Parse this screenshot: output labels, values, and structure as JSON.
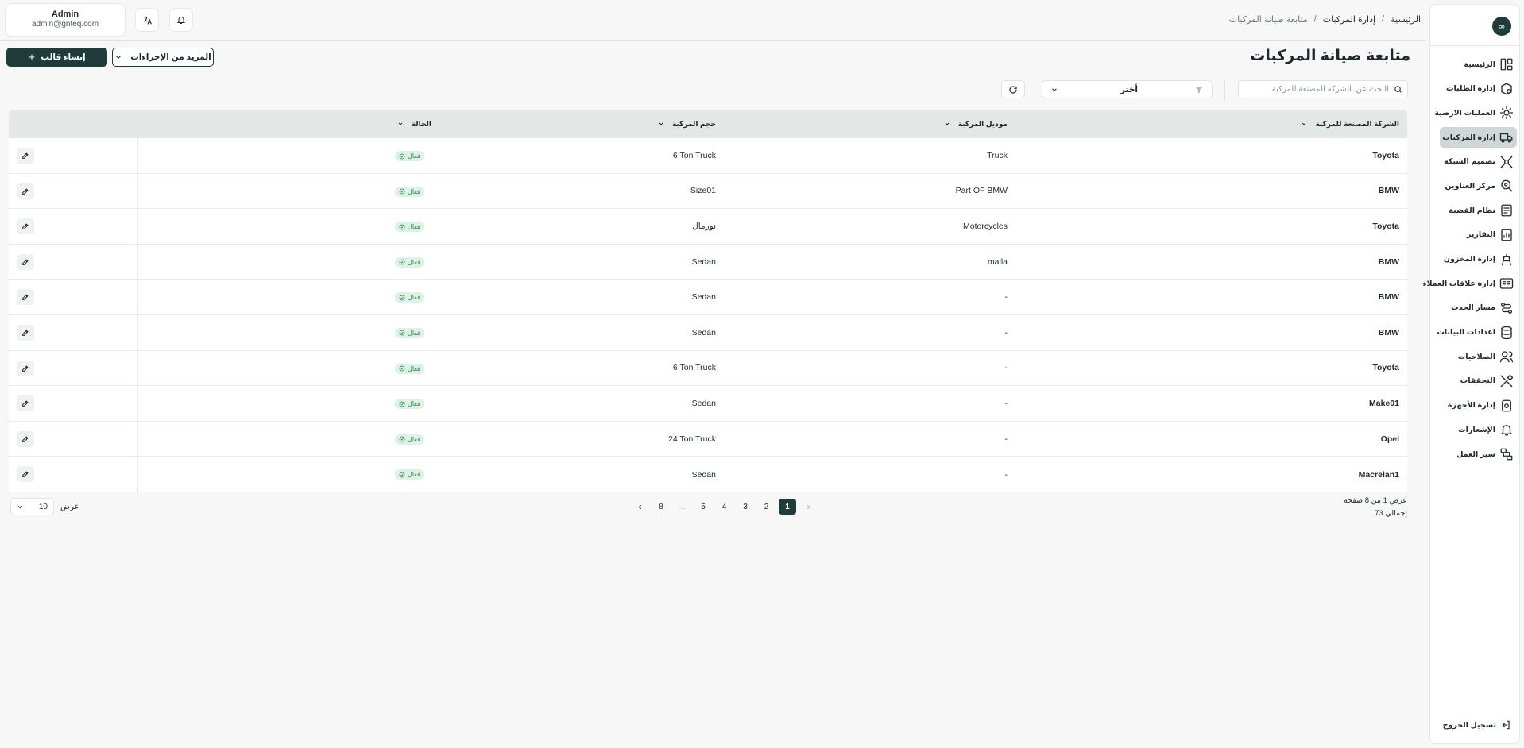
{
  "sidebar": {
    "logo_text": "∞",
    "items": [
      {
        "label": "الرئيسية",
        "icon": "layout-icon"
      },
      {
        "label": "إدارة الطلبات",
        "icon": "order-box-icon"
      },
      {
        "label": "العمليات الارضية",
        "icon": "sun-icon"
      },
      {
        "label": "إدارة المركبات",
        "icon": "truck-icon",
        "active": true
      },
      {
        "label": "تصميم الشبكة",
        "icon": "network-icon"
      },
      {
        "label": "مركز العناوين",
        "icon": "map-pin-icon"
      },
      {
        "label": "نظام القضية",
        "icon": "case-icon"
      },
      {
        "label": "التقارير",
        "icon": "report-icon"
      },
      {
        "label": "إدارة المخزون",
        "icon": "inventory-icon"
      },
      {
        "label": "إدارة علاقات العملاء",
        "icon": "crm-icon"
      },
      {
        "label": "مسار الحدث",
        "icon": "route-icon"
      },
      {
        "label": "اعدادات البيانات",
        "icon": "database-icon"
      },
      {
        "label": "الصلاحيات",
        "icon": "users-icon"
      },
      {
        "label": "التحققات",
        "icon": "tools-icon"
      },
      {
        "label": "إدارة الأجهزة",
        "icon": "device-icon"
      },
      {
        "label": "الإشعارات",
        "icon": "bell-icon"
      },
      {
        "label": "سير العمل",
        "icon": "workflow-icon"
      }
    ],
    "logout": "تسجيل الخروج"
  },
  "breadcrumb": {
    "home": "الرئيسية",
    "section": "إدارة المركبات",
    "current": "متابعة صيانة المركبات",
    "separator": "/"
  },
  "user": {
    "name": "Admin",
    "email": "admin@gnteq.com"
  },
  "page": {
    "title": "متابعة صيانة المركبات"
  },
  "toolbar": {
    "create_label": "إنشاء قالب",
    "more_label": "المزيد من الإجراءات"
  },
  "search": {
    "placeholder": "البحث عن  الشركة المصنعة للمركبة"
  },
  "filter": {
    "value": "أختر"
  },
  "table": {
    "headers": [
      "الشركة المصنعة للمركبة",
      "موديل المركبة",
      "حجم المركبة",
      "الحالة"
    ],
    "rows": [
      {
        "maker": "Toyota",
        "model": "Truck",
        "size": "6 Ton Truck",
        "status": "فعال"
      },
      {
        "maker": "BMW",
        "model": "Part OF BMW",
        "size": "Size01",
        "status": "فعال"
      },
      {
        "maker": "Toyota",
        "model": "Motorcycles",
        "size": "نورمال",
        "status": "فعال"
      },
      {
        "maker": "BMW",
        "model": "malla",
        "size": "Sedan",
        "status": "فعال"
      },
      {
        "maker": "BMW",
        "model": "-",
        "size": "Sedan",
        "status": "فعال"
      },
      {
        "maker": "BMW",
        "model": "-",
        "size": "Sedan",
        "status": "فعال"
      },
      {
        "maker": "Toyota",
        "model": "-",
        "size": "6 Ton Truck",
        "status": "فعال"
      },
      {
        "maker": "Make01",
        "model": "-",
        "size": "Sedan",
        "status": "فعال"
      },
      {
        "maker": "Opel",
        "model": "-",
        "size": "24 Ton Truck",
        "status": "فعال"
      },
      {
        "maker": "Macrelan1",
        "model": "-",
        "size": "Sedan",
        "status": "فعال"
      }
    ]
  },
  "pagination": {
    "info": "عرض 1 من 8 صفحة",
    "total": "إجمالي 73",
    "pages": [
      "1",
      "2",
      "3",
      "4",
      "5",
      "...",
      "8"
    ],
    "current": "1"
  },
  "per_page": {
    "label": "عرض",
    "value": "10"
  },
  "colors": {
    "primary": "#1f3b3a",
    "active_nav": "#cfd8d6",
    "status_bg": "#def1e5",
    "status_text": "#2e8a55"
  }
}
